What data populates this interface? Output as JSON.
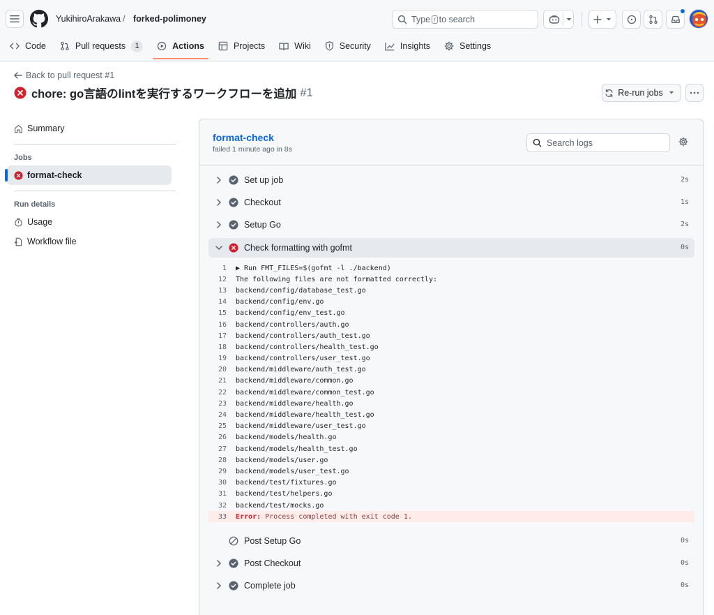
{
  "header": {
    "owner": "YukihiroArakawa",
    "separator": "/",
    "repo": "forked-polimoney",
    "search_prefix": "Type",
    "search_key": "/",
    "search_suffix": "to search"
  },
  "nav": {
    "tabs": [
      {
        "label": "Code",
        "icon": "code-icon"
      },
      {
        "label": "Pull requests",
        "icon": "git-pull-request-icon",
        "count": "1"
      },
      {
        "label": "Actions",
        "icon": "play-icon",
        "active": true
      },
      {
        "label": "Projects",
        "icon": "table-icon"
      },
      {
        "label": "Wiki",
        "icon": "book-icon"
      },
      {
        "label": "Security",
        "icon": "shield-icon"
      },
      {
        "label": "Insights",
        "icon": "graph-icon"
      },
      {
        "label": "Settings",
        "icon": "gear-icon"
      }
    ]
  },
  "page": {
    "back_label": "Back to pull request #1",
    "title": "chore: go言語のlintを実行するワークフローを追加",
    "title_number": "#1",
    "rerun_label": "Re-run jobs"
  },
  "sidebar": {
    "summary": "Summary",
    "jobs_heading": "Jobs",
    "job": "format-check",
    "run_details_heading": "Run details",
    "usage": "Usage",
    "workflow_file": "Workflow file"
  },
  "job": {
    "name": "format-check",
    "status": "failed 1 minute ago in 8s",
    "search_placeholder": "Search logs"
  },
  "steps": [
    {
      "name": "Set up job",
      "duration": "2s",
      "status": "success"
    },
    {
      "name": "Checkout",
      "duration": "1s",
      "status": "success"
    },
    {
      "name": "Setup Go",
      "duration": "2s",
      "status": "success"
    },
    {
      "name": "Check formatting with gofmt",
      "duration": "0s",
      "status": "failure",
      "expanded": true
    },
    {
      "name": "Post Setup Go",
      "duration": "0s",
      "status": "skipped"
    },
    {
      "name": "Post Checkout",
      "duration": "0s",
      "status": "success"
    },
    {
      "name": "Complete job",
      "duration": "0s",
      "status": "success"
    }
  ],
  "log_lines": [
    {
      "n": "1",
      "text": "▶ Run FMT_FILES=$(gofmt -l ./backend)"
    },
    {
      "n": "12",
      "text": "The following files are not formatted correctly:"
    },
    {
      "n": "13",
      "text": "backend/config/database_test.go"
    },
    {
      "n": "14",
      "text": "backend/config/env.go"
    },
    {
      "n": "15",
      "text": "backend/config/env_test.go"
    },
    {
      "n": "16",
      "text": "backend/controllers/auth.go"
    },
    {
      "n": "17",
      "text": "backend/controllers/auth_test.go"
    },
    {
      "n": "18",
      "text": "backend/controllers/health_test.go"
    },
    {
      "n": "19",
      "text": "backend/controllers/user_test.go"
    },
    {
      "n": "20",
      "text": "backend/middleware/auth_test.go"
    },
    {
      "n": "21",
      "text": "backend/middleware/common.go"
    },
    {
      "n": "22",
      "text": "backend/middleware/common_test.go"
    },
    {
      "n": "23",
      "text": "backend/middleware/health.go"
    },
    {
      "n": "24",
      "text": "backend/middleware/health_test.go"
    },
    {
      "n": "25",
      "text": "backend/middleware/user_test.go"
    },
    {
      "n": "26",
      "text": "backend/models/health.go"
    },
    {
      "n": "27",
      "text": "backend/models/health_test.go"
    },
    {
      "n": "28",
      "text": "backend/models/user.go"
    },
    {
      "n": "29",
      "text": "backend/models/user_test.go"
    },
    {
      "n": "30",
      "text": "backend/test/fixtures.go"
    },
    {
      "n": "31",
      "text": "backend/test/helpers.go"
    },
    {
      "n": "32",
      "text": "backend/test/mocks.go"
    }
  ],
  "error_line": {
    "n": "33",
    "label": "Error:",
    "text": " Process completed with exit code 1."
  },
  "colors": {
    "accent": "#0969da",
    "failure": "#cf222e",
    "success": "#59636e",
    "active_tab_underline": "#fd8c73"
  }
}
